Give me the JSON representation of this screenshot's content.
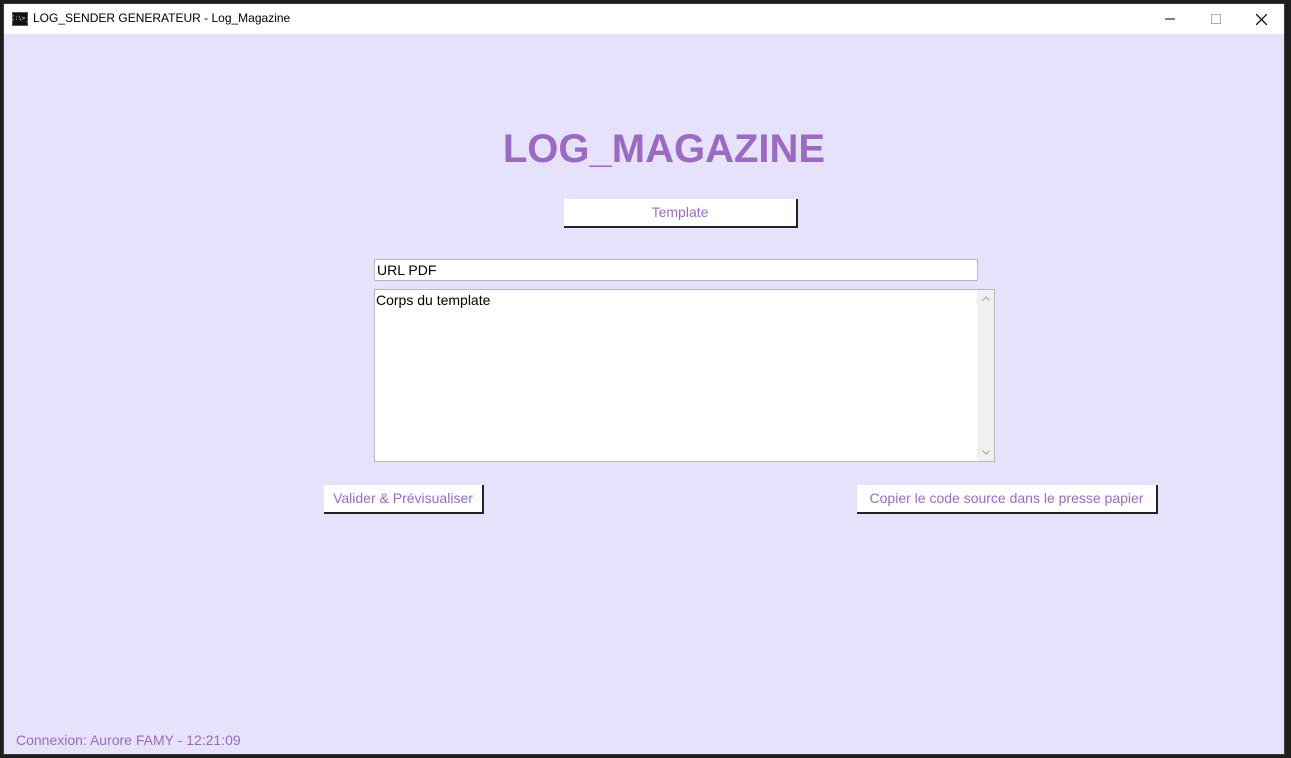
{
  "window": {
    "title": "LOG_SENDER GENERATEUR - Log_Magazine",
    "icon_label": "C:\\>_"
  },
  "main": {
    "heading": "LOG_MAGAZINE",
    "template_button": "Template",
    "url_field": {
      "value": "URL PDF"
    },
    "body_field": {
      "value": "Corps du template"
    },
    "validate_button": "Valider & Prévisualiser",
    "copy_button": "Copier le code source dans le presse papier"
  },
  "status_bar": {
    "text": "Connexion: Aurore FAMY - 12:21:09"
  },
  "colors": {
    "accent": "#9b6bc1",
    "background": "#e6e2fc",
    "titlebar": "#ffffff"
  }
}
